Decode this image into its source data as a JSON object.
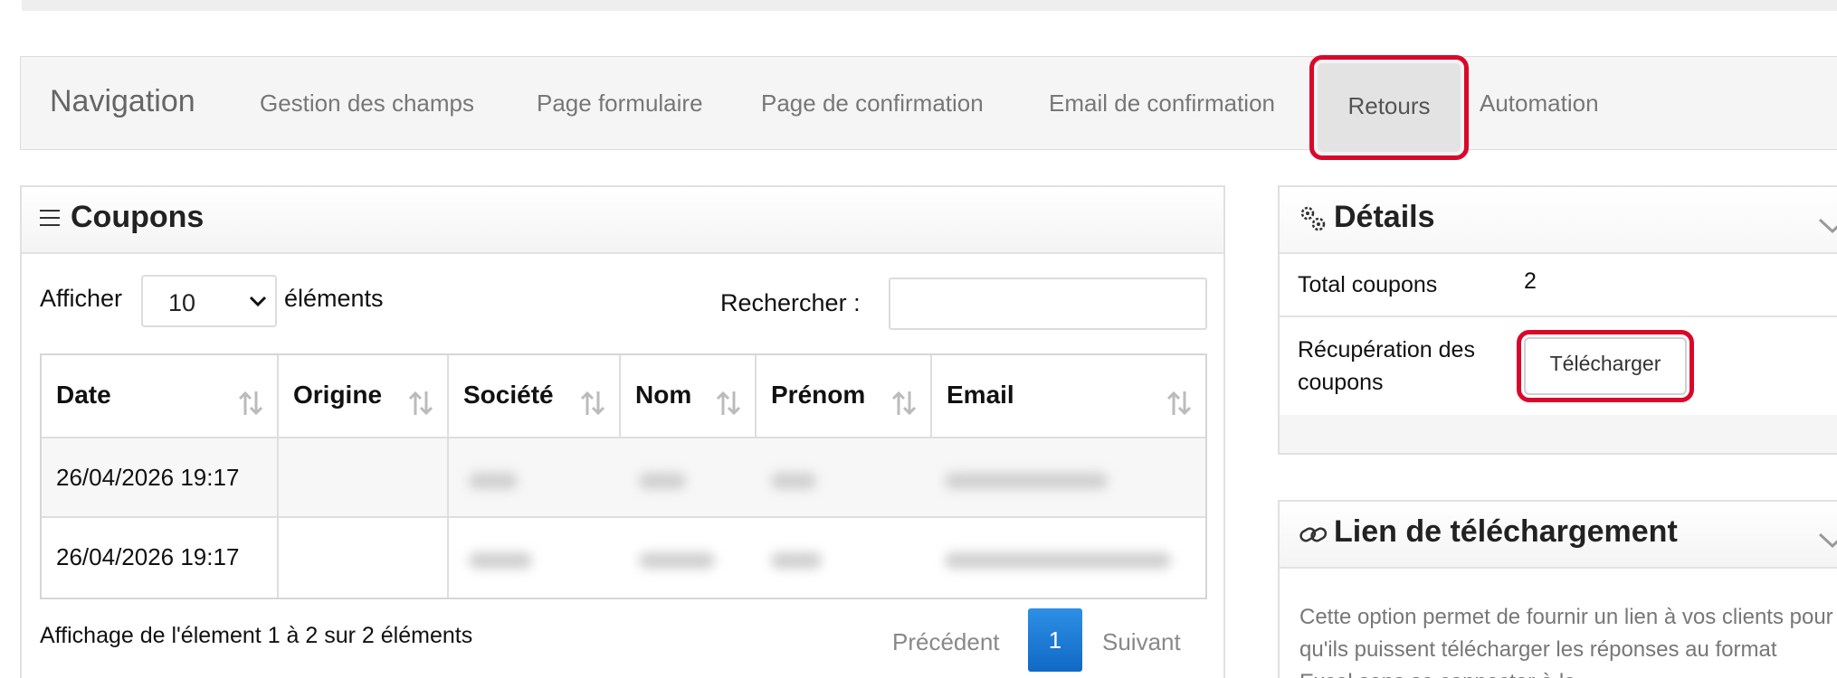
{
  "nav": {
    "brand": "Navigation",
    "items": [
      "Gestion des champs",
      "Page formulaire",
      "Page de confirmation",
      "Email de confirmation",
      "Retours",
      "Automation"
    ],
    "active": "Retours"
  },
  "coupons_panel": {
    "title": "Coupons",
    "show_label": "Afficher",
    "show_value": "10",
    "show_suffix": "éléments",
    "search_label": "Rechercher :",
    "search_value": "",
    "columns": [
      "Date",
      "Origine",
      "Société",
      "Nom",
      "Prénom",
      "Email"
    ],
    "rows": [
      {
        "date": "26/04/2026 19:17",
        "origine": ""
      },
      {
        "date": "26/04/2026 19:17",
        "origine": ""
      }
    ],
    "info": "Affichage de l'élement 1 à 2 sur 2 éléments",
    "pagination": {
      "prev": "Précédent",
      "current": "1",
      "next": "Suivant"
    }
  },
  "details_panel": {
    "title": "Détails",
    "total_label": "Total coupons",
    "total_value": "2",
    "recup_label_line1": "Récupération des",
    "recup_label_line2": "coupons",
    "download_label": "Télécharger"
  },
  "lien_panel": {
    "title": "Lien de téléchargement",
    "text": "Cette option permet de fournir un lien à vos clients pour qu'ils puissent télécharger les réponses au format Excel sans se connecter à la"
  },
  "colors": {
    "highlight": "#d9082b",
    "pager_active": "#1a7ad6"
  }
}
